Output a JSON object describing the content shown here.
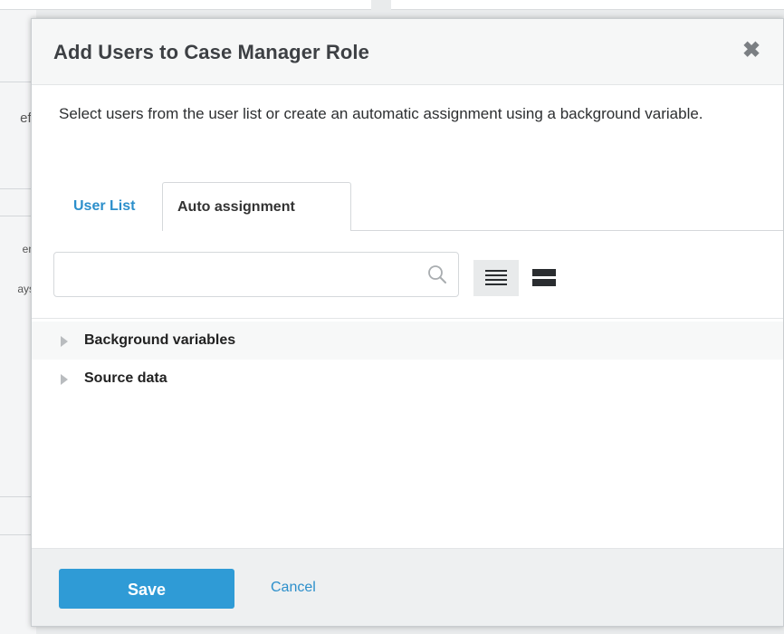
{
  "background": {
    "fragments": [
      "efi",
      "en",
      "ays"
    ]
  },
  "modal": {
    "title": "Add Users to Case Manager Role",
    "close_icon": "close-icon",
    "description": "Select users from the user list or create an automatic assignment using a background variable.",
    "tabs": [
      {
        "label": "User List",
        "active": false
      },
      {
        "label": "Auto assignment",
        "active": true
      }
    ],
    "search": {
      "value": "",
      "placeholder": "",
      "icon": "search-icon"
    },
    "view_toggle": {
      "compact_icon": "list-compact-icon",
      "expanded_icon": "list-expanded-icon",
      "selected": "compact"
    },
    "tree": [
      {
        "label": "Background variables",
        "expanded": false
      },
      {
        "label": "Source data",
        "expanded": false
      }
    ],
    "footer": {
      "save_label": "Save",
      "cancel_label": "Cancel"
    }
  },
  "colors": {
    "accent": "#2f9bd6",
    "link": "#2c8fcb",
    "title": "#3d4044"
  }
}
